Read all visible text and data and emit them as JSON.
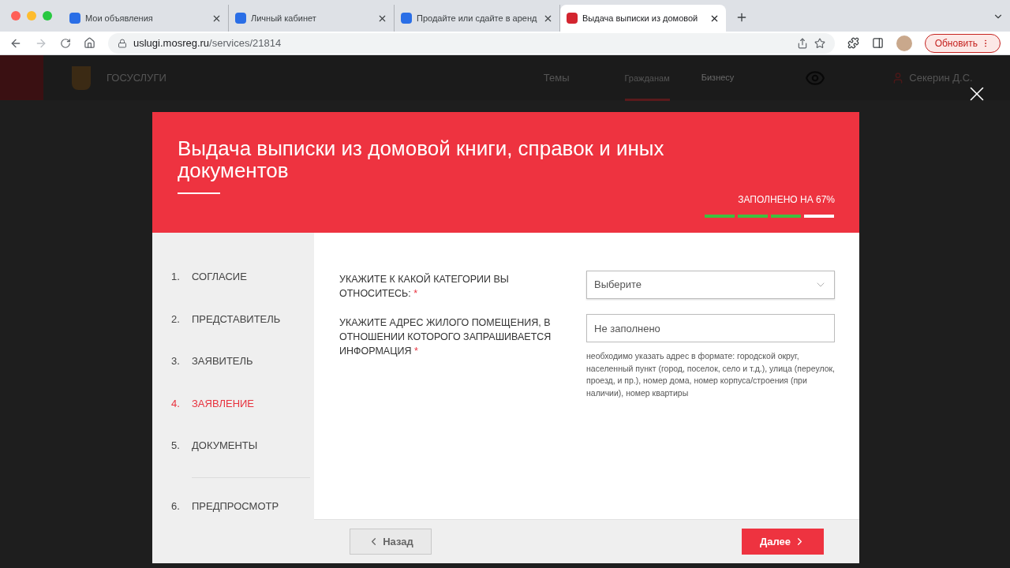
{
  "browser": {
    "tabs": [
      {
        "title": "Мои объявления",
        "selected": false
      },
      {
        "title": "Личный кабинет",
        "selected": false
      },
      {
        "title": "Продайте или сдайте в аренд",
        "selected": false
      },
      {
        "title": "Выдача выписки из домовой",
        "selected": true
      }
    ],
    "url_host": "uslugi.mosreg.ru",
    "url_path": "/services/21814",
    "update_button": "Обновить"
  },
  "site_header": {
    "logo": "ГОСУСЛУГИ",
    "nav": [
      {
        "label": "Темы",
        "selected": false
      },
      {
        "label": "Гражданам",
        "selected": true
      },
      {
        "label": "Бизнесу",
        "selected": false
      }
    ],
    "user": "Секерин Д.С."
  },
  "modal": {
    "title": "Выдача выписки из домовой книги, справок и иных документов",
    "progress_label": "ЗАПОЛНЕНО НА 67%",
    "progress_segments": [
      {
        "done": true
      },
      {
        "done": true
      },
      {
        "done": true
      },
      {
        "done": false
      }
    ],
    "steps": [
      {
        "number": "1.",
        "label": "СОГЛАСИЕ",
        "selected": false
      },
      {
        "number": "2.",
        "label": "ПРЕДСТАВИТЕЛЬ",
        "selected": false
      },
      {
        "number": "3.",
        "label": "ЗАЯВИТЕЛЬ",
        "selected": false
      },
      {
        "number": "4.",
        "label": "ЗАЯВЛЕНИЕ",
        "selected": true
      },
      {
        "number": "5.",
        "label": "ДОКУМЕНТЫ",
        "selected": false
      },
      {
        "number": "6.",
        "label": "ПРЕДПРОСМОТР",
        "selected": false
      }
    ],
    "fields": [
      {
        "kind": "select",
        "label": "УКАЖИТЕ К КАКОЙ КАТЕГОРИИ ВЫ ОТНОСИТЕСЬ:",
        "required_mark": "*",
        "placeholder": "Выберите"
      },
      {
        "kind": "text",
        "label": "УКАЖИТЕ АДРЕС ЖИЛОГО ПОМЕЩЕНИЯ, В ОТНОШЕНИИ КОТОРОГО ЗАПРАШИВАЕТСЯ ИНФОРМАЦИЯ",
        "required_mark": "*",
        "placeholder": "Не заполнено",
        "hint": "необходимо указать адрес в формате: городской округ, населенный пункт (город, поселок, село и т.д.), улица (переулок, проезд, и пр.), номер дома, номер корпуса/строения (при наличии), номер квартиры"
      }
    ],
    "back_button": "Назад",
    "next_button": "Далее"
  }
}
